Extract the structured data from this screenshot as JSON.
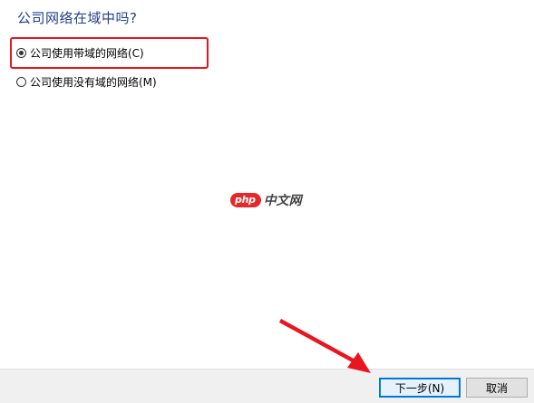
{
  "question": "公司网络在域中吗?",
  "options": [
    {
      "label": "公司使用带域的网络(C)",
      "selected": true
    },
    {
      "label": "公司使用没有域的网络(M)",
      "selected": false
    }
  ],
  "watermark": {
    "badge": "php",
    "text": "中文网"
  },
  "buttons": {
    "next_label": "下一步(N)",
    "cancel_label": "取消"
  },
  "colors": {
    "question_text": "#1e3f8f",
    "annotation_red": "#e8161f",
    "default_button_border": "#0078d7",
    "footer_background": "#f0f0f0"
  },
  "annotations": {
    "highlight_box": "red-rectangle-around-selected-option",
    "arrow": "red-arrow-pointing-to-next-button"
  }
}
